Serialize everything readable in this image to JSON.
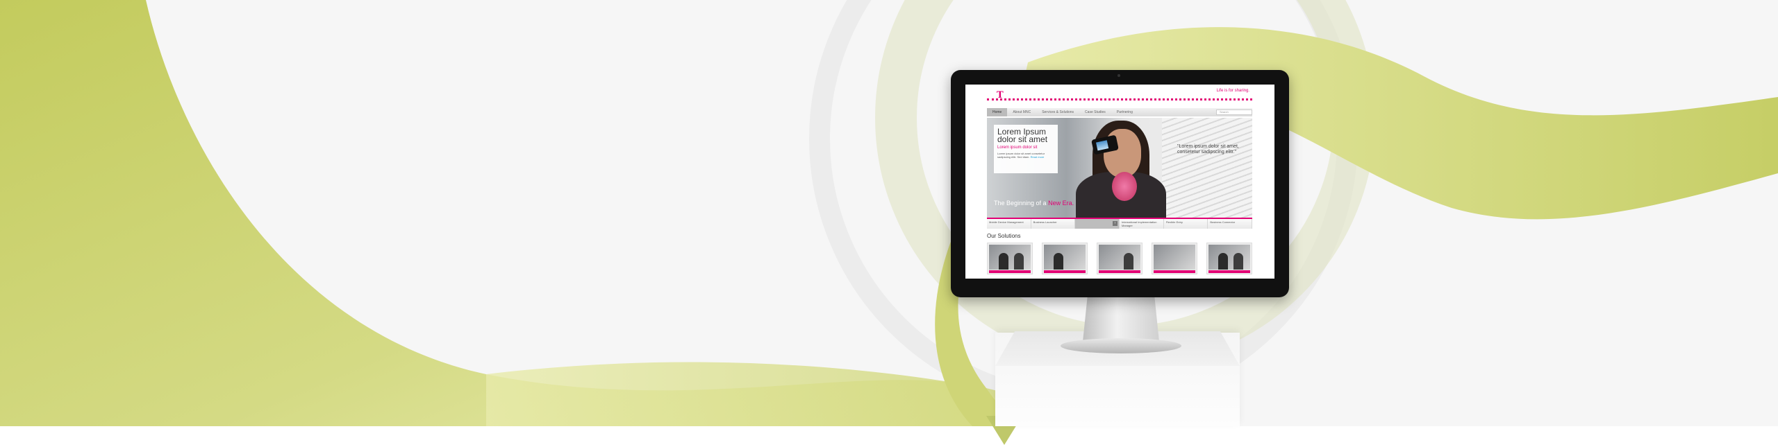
{
  "website": {
    "tagline": "Life is for sharing.",
    "logo_text": "T",
    "nav": [
      {
        "label": "Home"
      },
      {
        "label": "About MNC"
      },
      {
        "label": "Services & Solutions"
      },
      {
        "label": "Case Studies"
      },
      {
        "label": "Partnering"
      }
    ],
    "search_placeholder": "Search",
    "banner": {
      "title": "Lorem Ipsum dolor sit amet",
      "subtitle": "Lorem ipsum dolor sit",
      "body": "Lorem ipsum dolor sit amet consetetur sadipscing elitr. Sed diam.",
      "link": "Read more",
      "quote": "\"Lorem ipsum dolor sit amet, consetetur sadipscing elitr.\"",
      "claim_prefix": "The Beginning of a",
      "claim_highlight": "New Era."
    },
    "features": [
      {
        "label": "Mobile Device Management"
      },
      {
        "label": "Business Launcher"
      },
      {
        "label": ""
      },
      {
        "label": "International Implementation Manager"
      },
      {
        "label": "Flexible Entry"
      },
      {
        "label": "Business Connector"
      }
    ],
    "solutions_title": "Our Solutions",
    "colors": {
      "magenta": "#e20074",
      "accent_green": "#c4cc5f"
    }
  }
}
